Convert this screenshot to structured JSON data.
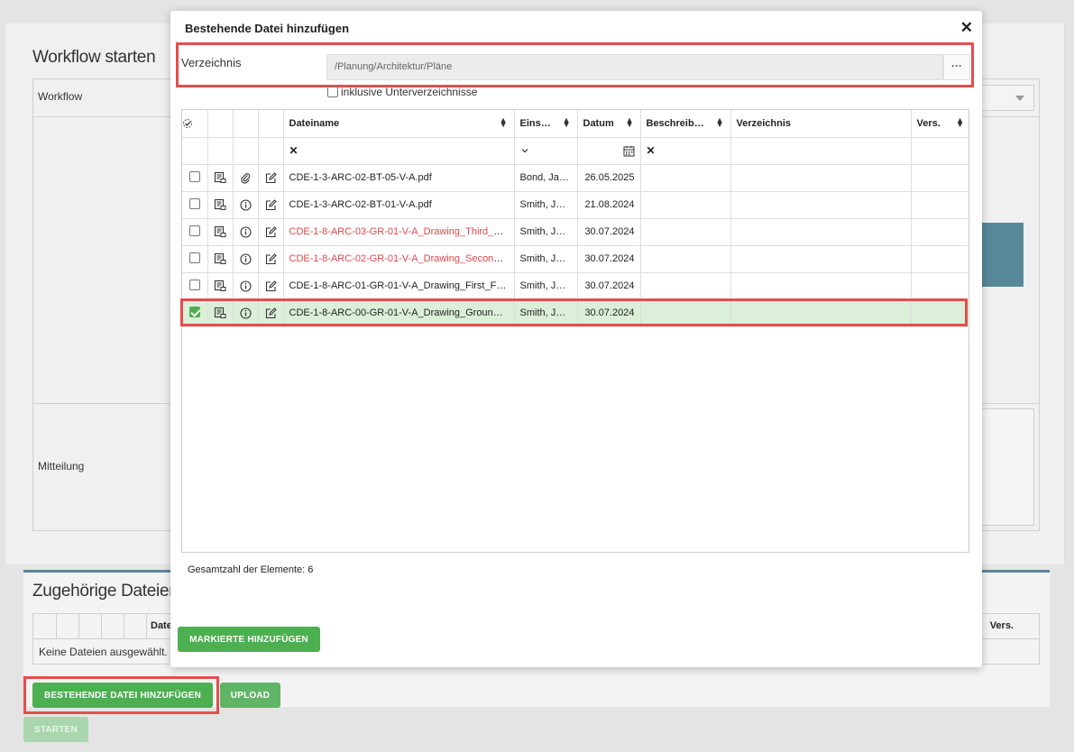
{
  "background": {
    "title": "Workflow starten",
    "workflow_label": "Workflow",
    "message_label": "Mitteilung",
    "files_title": "Zugehörige Dateien",
    "files_header_date": "Date",
    "files_header_vers": "Vers.",
    "files_empty": "Keine Dateien ausgewählt.",
    "add_existing_button": "BESTEHENDE DATEI HINZUFÜGEN",
    "upload_button": "UPLOAD",
    "start_button": "STARTEN"
  },
  "modal": {
    "title": "Bestehende Datei hinzufügen",
    "close": "✕",
    "directory_label": "Verzeichnis",
    "directory_value": "/Planung/Architektur/Pläne",
    "directory_browse": "···",
    "include_subdirs_label": "inklusive Unterverzeichnisse",
    "columns": {
      "filename": "Dateiname",
      "uploader": "Eins…",
      "date": "Datum",
      "description": "Beschreib…",
      "directory": "Verzeichnis",
      "version": "Vers."
    },
    "filter_clear": "✕",
    "rows": [
      {
        "checked": false,
        "attach_icon": "paperclip-icon",
        "filename": "CDE-1-3-ARC-02-BT-05-V-A.pdf",
        "red": false,
        "uploader": "Bond, Ja…",
        "date": "26.05.2025"
      },
      {
        "checked": false,
        "attach_icon": "info-icon",
        "filename": "CDE-1-3-ARC-02-BT-01-V-A.pdf",
        "red": false,
        "uploader": "Smith, J…",
        "date": "21.08.2024"
      },
      {
        "checked": false,
        "attach_icon": "info-icon",
        "filename": "CDE-1-8-ARC-03-GR-01-V-A_Drawing_Third_Fl…",
        "red": true,
        "uploader": "Smith, J…",
        "date": "30.07.2024"
      },
      {
        "checked": false,
        "attach_icon": "info-icon",
        "filename": "CDE-1-8-ARC-02-GR-01-V-A_Drawing_Second_…",
        "red": true,
        "uploader": "Smith, J…",
        "date": "30.07.2024"
      },
      {
        "checked": false,
        "attach_icon": "info-icon",
        "filename": "CDE-1-8-ARC-01-GR-01-V-A_Drawing_First_Flo…",
        "red": false,
        "uploader": "Smith, J…",
        "date": "30.07.2024"
      },
      {
        "checked": true,
        "attach_icon": "info-icon",
        "filename": "CDE-1-8-ARC-00-GR-01-V-A_Drawing_Ground_…",
        "red": false,
        "uploader": "Smith, J…",
        "date": "30.07.2024"
      }
    ],
    "total_label": "Gesamtzahl der Elemente: 6",
    "add_marked_button": "MARKIERTE HINZUFÜGEN"
  },
  "colors": {
    "accent_green": "#4caf50",
    "highlight_red": "#e44d4d",
    "link_red": "#e0474c",
    "selected_row": "#dcefd8",
    "teal": "#57889a"
  }
}
